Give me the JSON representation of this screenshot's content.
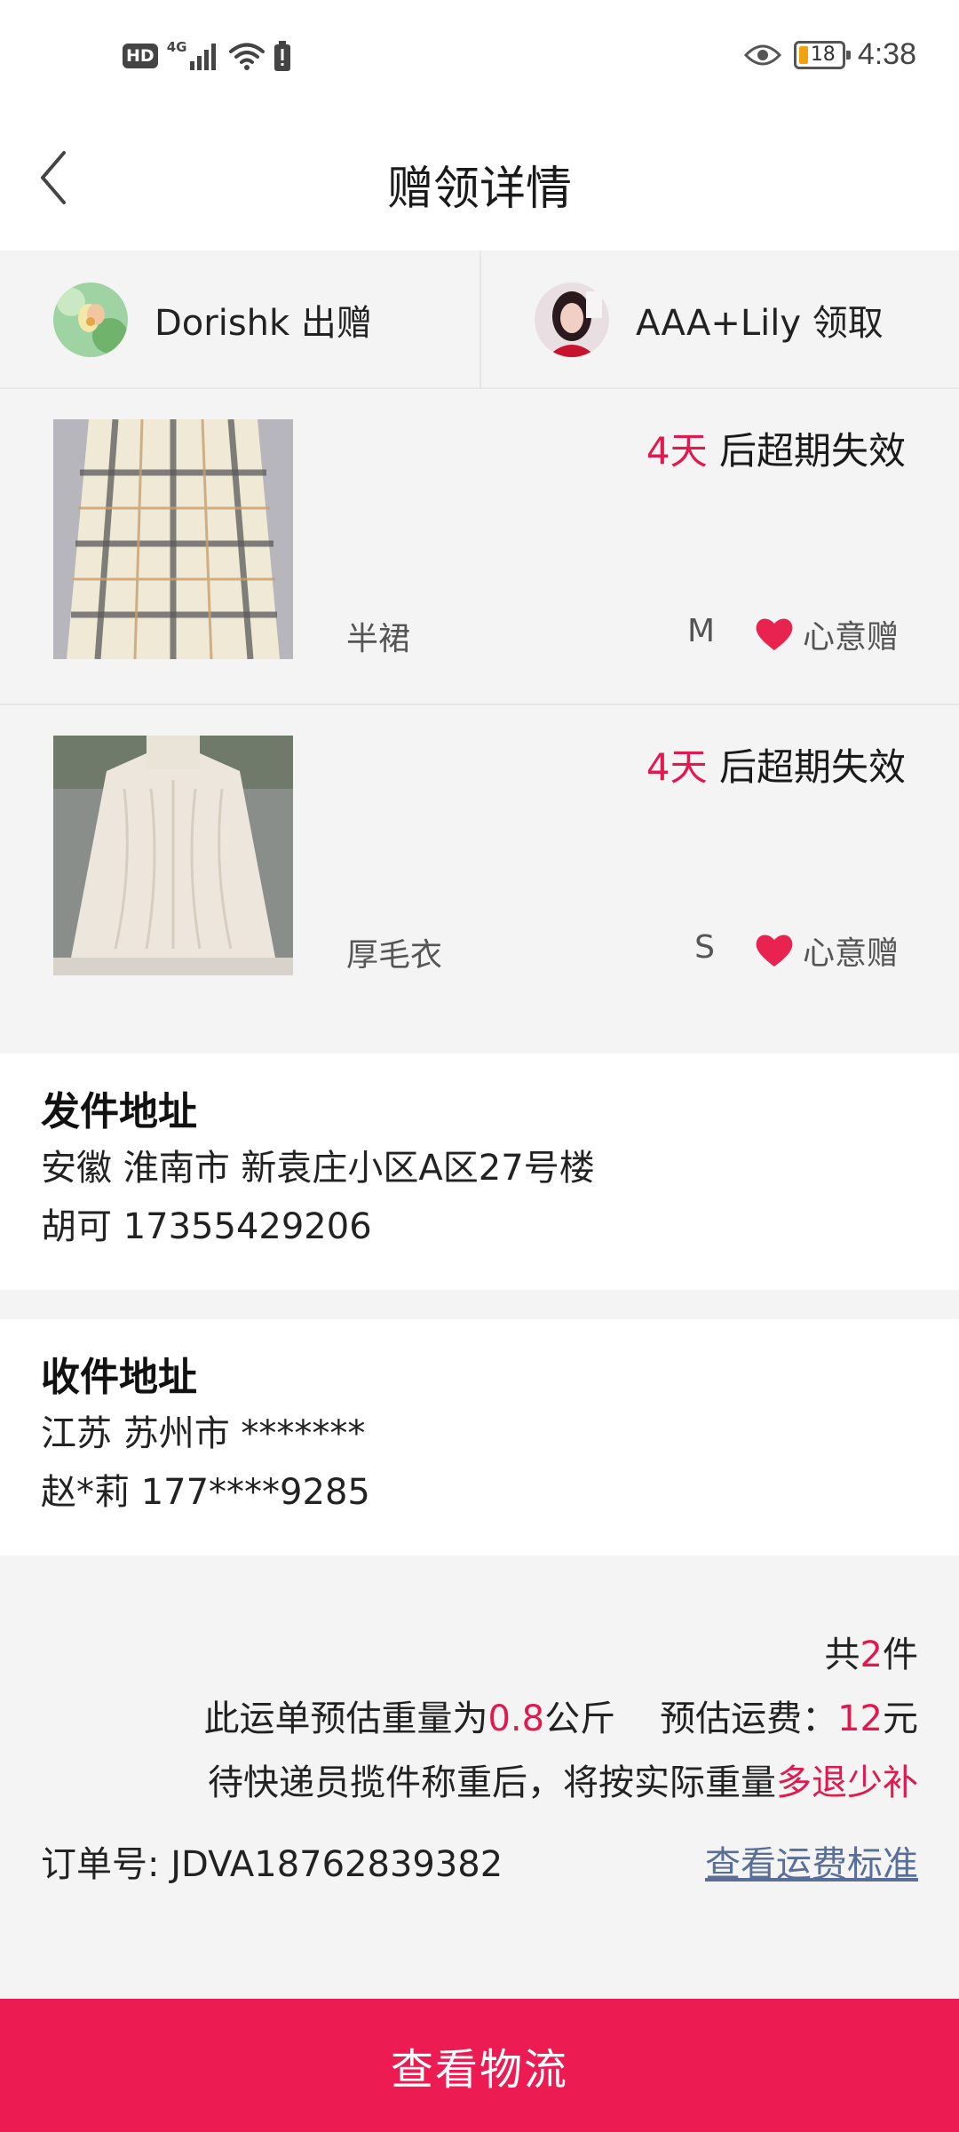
{
  "status_bar": {
    "hd": "HD",
    "network": "4G",
    "battery_level": "18",
    "time": "4:38"
  },
  "header": {
    "title": "赠领详情"
  },
  "users": {
    "giver": "Dorishk 出赠",
    "receiver": "AAA+Lily 领取"
  },
  "items": [
    {
      "expire_days": "4天",
      "expire_suffix": " 后超期失效",
      "name": "半裙",
      "size": "M",
      "gift_label": "心意赠"
    },
    {
      "expire_days": "4天",
      "expire_suffix": " 后超期失效",
      "name": "厚毛衣",
      "size": "S",
      "gift_label": "心意赠"
    }
  ],
  "send_address": {
    "title": "发件地址",
    "line1": "安徽 淮南市 新袁庄小区A区27号楼",
    "line2": "胡可 17355429206"
  },
  "recv_address": {
    "title": "收件地址",
    "line1": "江苏 苏州市 *******",
    "line2": "赵*莉 177****9285"
  },
  "summary": {
    "count_prefix": "共",
    "count": "2",
    "count_suffix": "件",
    "weight_prefix": "此运单预估重量为",
    "weight": "0.8",
    "weight_unit": "公斤",
    "fee_prefix": "预估运费：",
    "fee": "12",
    "fee_unit": "元",
    "note_prefix": "待快递员揽件称重后，将按实际重量",
    "note_highlight": "多退少补",
    "order_label": "订单号: JDVA18762839382",
    "fee_link": "查看运费标准"
  },
  "bottom_button": "查看物流",
  "colors": {
    "accent": "#e0194f",
    "button": "#ec1c52",
    "link": "#5a6f97"
  }
}
